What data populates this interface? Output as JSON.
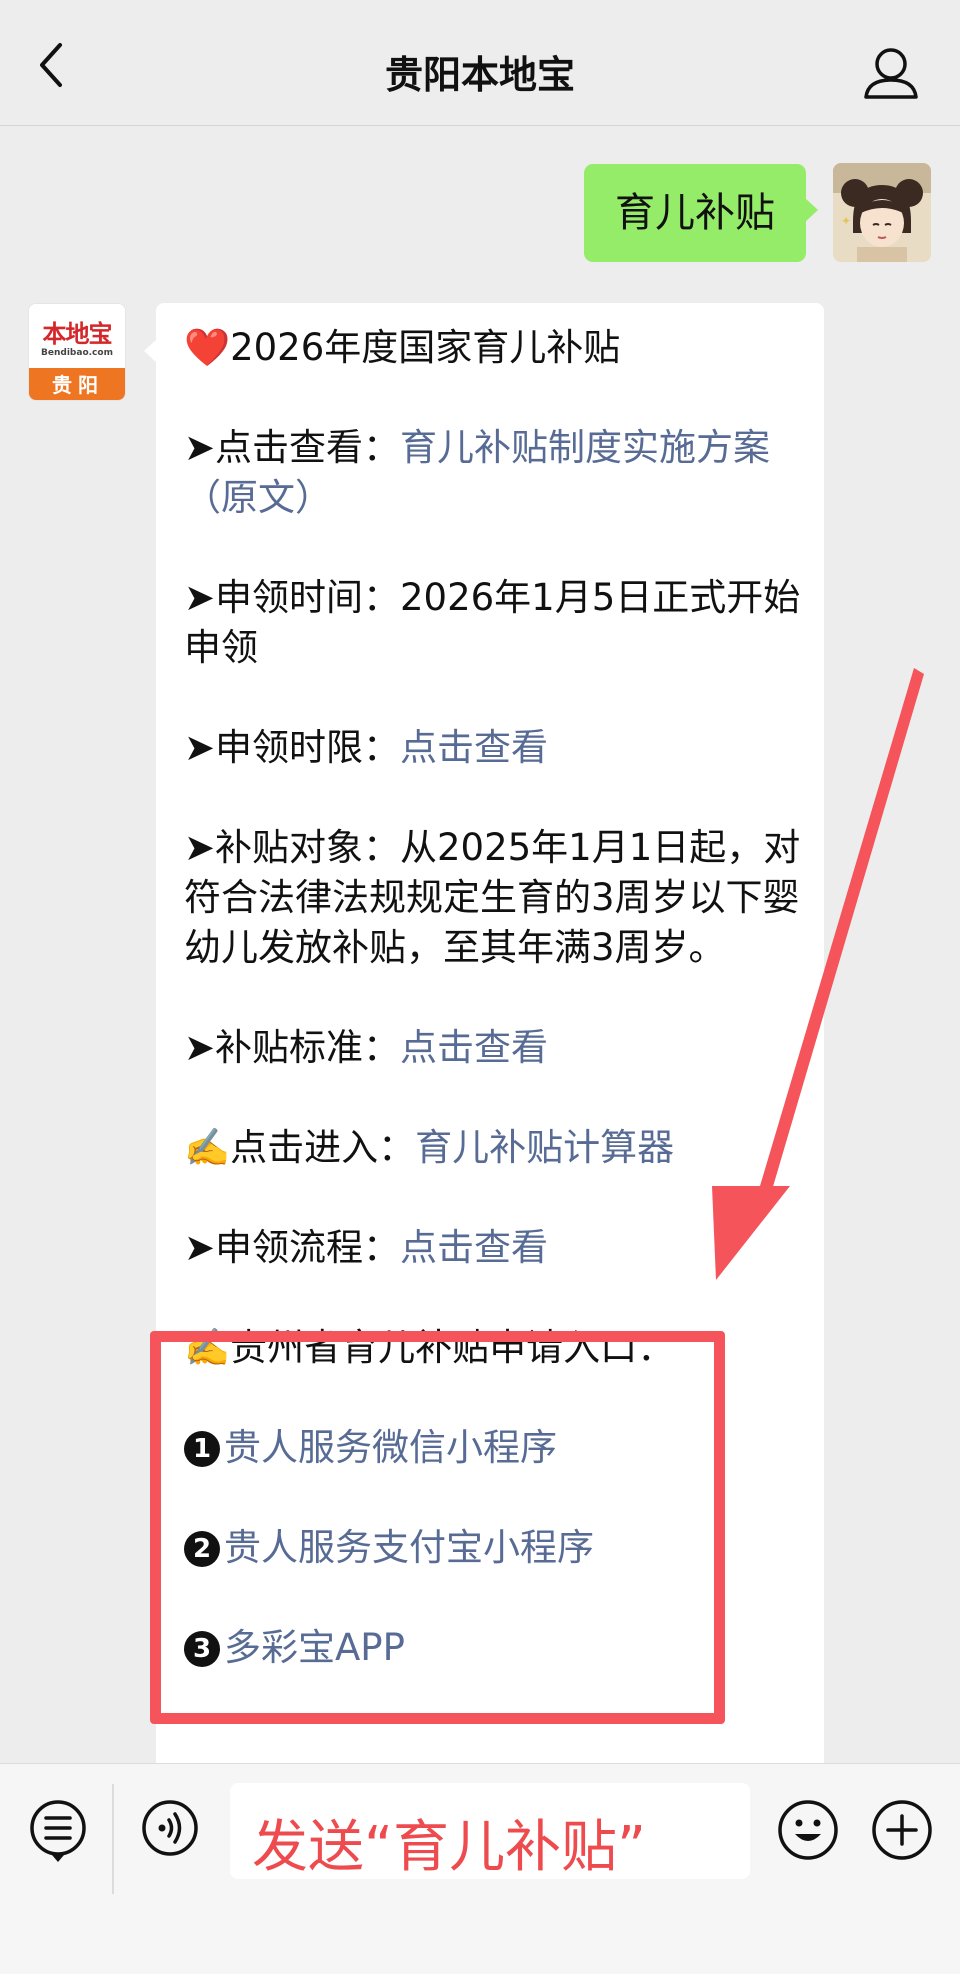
{
  "header": {
    "title": "贵阳本地宝",
    "back_icon": "chevron-left-icon",
    "profile_icon": "person-icon"
  },
  "outgoing": {
    "text": "育儿补贴"
  },
  "bot_avatar": {
    "brand": "本地宝",
    "domain": "Bendibao.com",
    "city": "贵阳"
  },
  "message": {
    "title_emoji": "❤️",
    "title": "2026年度国家育儿补贴",
    "marker": "➤",
    "pen_emoji": "✍️",
    "lines": [
      {
        "label": "点击查看：",
        "link": "育儿补贴制度实施方案（原文）"
      },
      {
        "label": "申领时间：",
        "text": "2026年1月5日正式开始申领"
      },
      {
        "label": "申领时限：",
        "link": "点击查看"
      },
      {
        "label": "补贴对象：",
        "text": "从2025年1月1日起，对符合法律法规规定生育的3周岁以下婴幼儿发放补贴，至其年满3周岁。"
      },
      {
        "label": "补贴标准：",
        "link": "点击查看"
      },
      {
        "label": "点击进入：",
        "link": "育儿补贴计算器"
      },
      {
        "label": "申领流程：",
        "link": "点击查看"
      }
    ],
    "entry_title": "贵州省育儿补贴申请入口：",
    "entries": [
      {
        "num": "1",
        "link": "贵人服务微信小程序"
      },
      {
        "num": "2",
        "link": "贵人服务支付宝小程序"
      },
      {
        "num": "3",
        "link": "多彩宝APP"
      }
    ]
  },
  "input_bar": {
    "overlay_text": "发送“育儿补贴”",
    "voice_icon": "voice-icon",
    "menu_icon": "menu-list-icon",
    "emoji_icon": "emoji-icon",
    "plus_icon": "plus-icon"
  },
  "colors": {
    "link": "#576b95",
    "bubble_green": "#95ec69",
    "annotation_red": "#f4545a"
  }
}
